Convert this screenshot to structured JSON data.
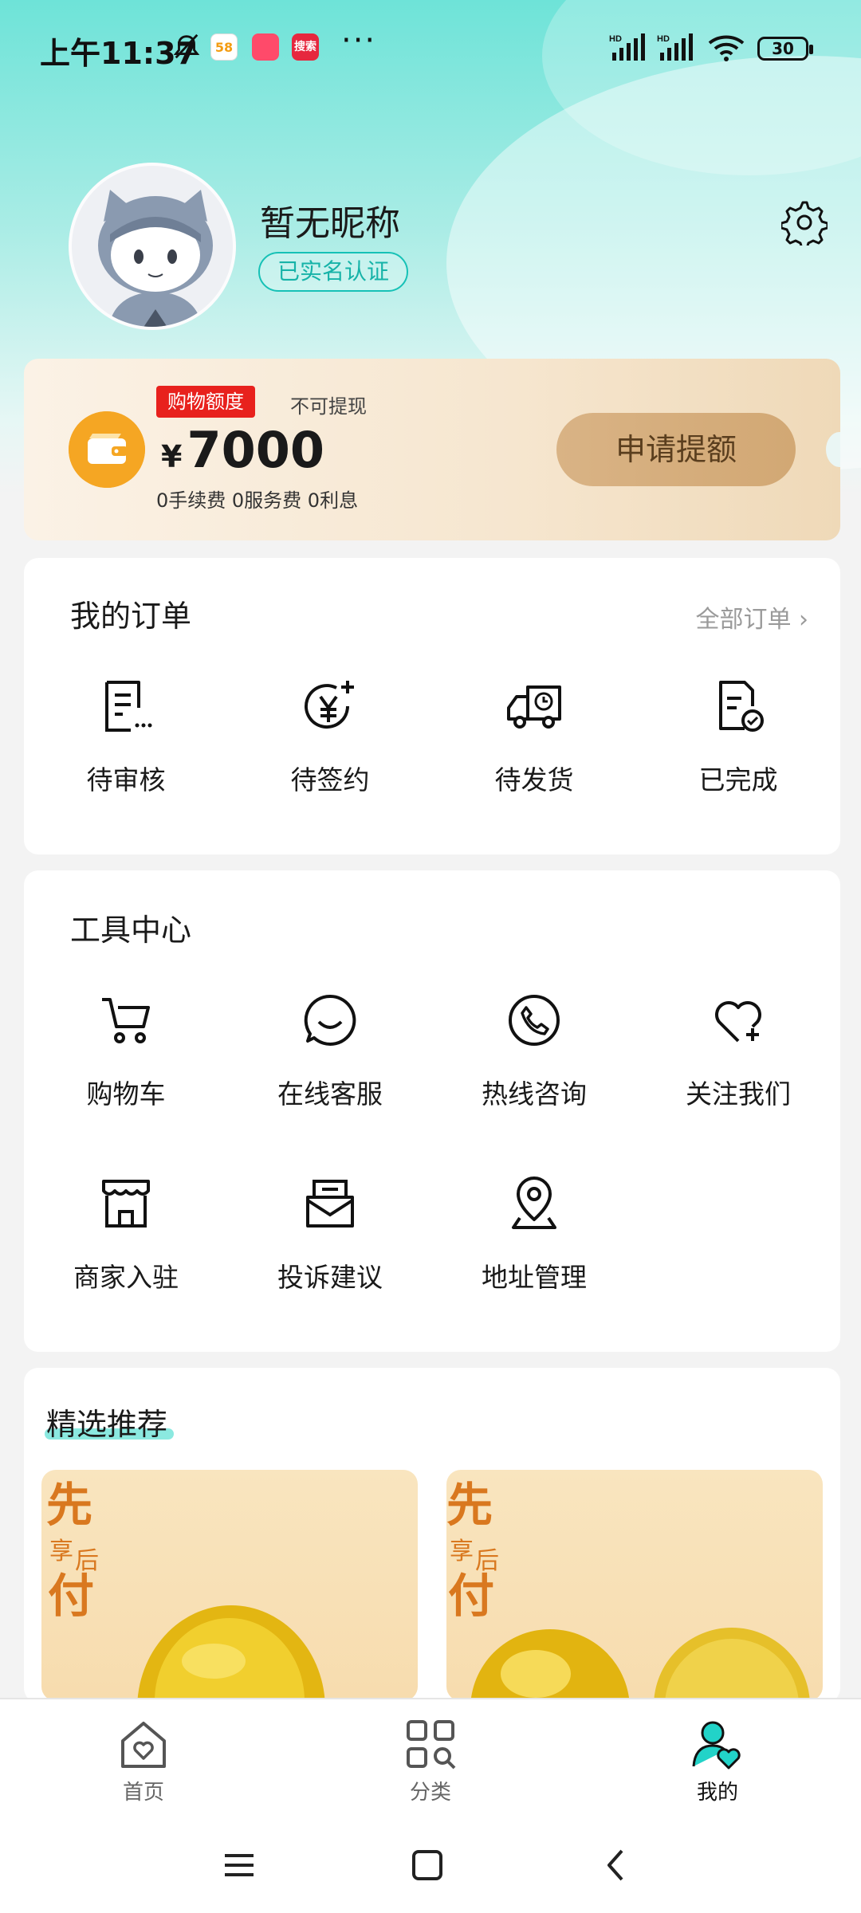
{
  "status_bar": {
    "time": "上午11:37",
    "battery": "30",
    "app1": "58",
    "app2": "",
    "app3": "搜索",
    "more": "···"
  },
  "profile": {
    "nickname": "暂无昵称",
    "verified_label": "已实名认证"
  },
  "credit": {
    "tag": "购物额度",
    "note": "不可提现",
    "currency": "¥",
    "amount": "7000",
    "fees": "0手续费 0服务费 0利息",
    "apply_label": "申请提额"
  },
  "orders": {
    "title": "我的订单",
    "all_label": "全部订单 ›",
    "items": [
      {
        "label": "待审核",
        "icon": "document-list-icon"
      },
      {
        "label": "待签约",
        "icon": "yen-plus-icon"
      },
      {
        "label": "待发货",
        "icon": "delivery-truck-icon"
      },
      {
        "label": "已完成",
        "icon": "document-check-icon"
      }
    ]
  },
  "tools": {
    "title": "工具中心",
    "items": [
      {
        "label": "购物车",
        "icon": "cart-icon"
      },
      {
        "label": "在线客服",
        "icon": "chat-smile-icon"
      },
      {
        "label": "热线咨询",
        "icon": "phone-icon"
      },
      {
        "label": "关注我们",
        "icon": "heart-plus-icon"
      },
      {
        "label": "商家入驻",
        "icon": "store-icon"
      },
      {
        "label": "投诉建议",
        "icon": "mail-open-icon"
      },
      {
        "label": "地址管理",
        "icon": "location-pin-icon"
      }
    ]
  },
  "recommend": {
    "title": "精选推荐"
  },
  "tabbar": {
    "items": [
      {
        "label": "首页",
        "icon": "home-heart-icon",
        "active": false
      },
      {
        "label": "分类",
        "icon": "category-search-icon",
        "active": false
      },
      {
        "label": "我的",
        "icon": "user-heart-icon",
        "active": true
      }
    ]
  },
  "colors": {
    "accent": "#16c1b6",
    "tag_red": "#e8211d",
    "apply_button": "#d6ae7d",
    "wallet": "#f5a623"
  }
}
